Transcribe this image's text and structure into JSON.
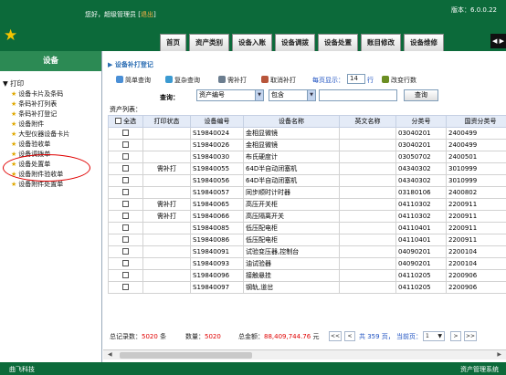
{
  "header": {
    "greeting_prefix": "您好，超级管理员 [",
    "logout": "退出",
    "greeting_suffix": "]",
    "version": "版本：6.0.0.22",
    "nav_tabs": [
      "首页",
      "资产类别",
      "设备入账",
      "设备调拨",
      "设备处置",
      "账目修改",
      "设备维修"
    ],
    "nav_arrows": "◀ ▶"
  },
  "sidebar": {
    "title": "设备",
    "root": "打印",
    "items": [
      "设备卡片及条码",
      "条码补打列表",
      "条码补打登记",
      "设备附件",
      "大型仪器设备卡片",
      "设备验收单",
      "设备调拨单",
      "设备处置单",
      "设备附件验收单",
      "设备附件处置单"
    ]
  },
  "main": {
    "breadcrumb": "设备补打登记",
    "toolbar": {
      "simple_query": "简单查询",
      "complex_query": "复杂查询",
      "reprint": "需补打",
      "cancel_reprint": "取消补打",
      "per_page_label": "每页显示：",
      "per_page_value": "14",
      "per_page_unit": "行",
      "set_rows": "改变行数"
    },
    "query": {
      "label": "查询：",
      "field": "资产编号",
      "operator": "包含",
      "value": "",
      "button": "查询"
    },
    "list_label": "资产列表：",
    "table": {
      "columns": [
        "全选",
        "打印状态",
        "设备编号",
        "设备名称",
        "英文名称",
        "分类号",
        "国资分类号"
      ],
      "rows": [
        [
          "",
          "S19840024",
          "金相显微镜",
          "",
          "03040201",
          "2400499"
        ],
        [
          "",
          "S19840026",
          "金相显微镜",
          "",
          "03040201",
          "2400499"
        ],
        [
          "",
          "S19840030",
          "布氏硬度计",
          "",
          "03050702",
          "2400501"
        ],
        [
          "需补打",
          "S19840055",
          "64D半自动闭塞机",
          "",
          "04340302",
          "3010999"
        ],
        [
          "",
          "S19840056",
          "64D半自动闭塞机",
          "",
          "04340302",
          "3010999"
        ],
        [
          "",
          "S19840057",
          "同步顺时计时器",
          "",
          "03180106",
          "2400802"
        ],
        [
          "需补打",
          "S19840065",
          "高压开关柜",
          "",
          "04110302",
          "2200911"
        ],
        [
          "需补打",
          "S19840066",
          "高压隔离开关",
          "",
          "04110302",
          "2200911"
        ],
        [
          "",
          "S19840085",
          "低压配电柜",
          "",
          "04110401",
          "2200911"
        ],
        [
          "",
          "S19840086",
          "低压配电柜",
          "",
          "04110401",
          "2200911"
        ],
        [
          "",
          "S19840091",
          "试验变压器,控制台",
          "",
          "04090201",
          "2200104"
        ],
        [
          "",
          "S19840093",
          "油试验器",
          "",
          "04090201",
          "2200104"
        ],
        [
          "",
          "S19840096",
          "接触悬挂",
          "",
          "04110205",
          "2200906"
        ],
        [
          "",
          "S19840097",
          "钢轨,道岔",
          "",
          "04110205",
          "2200906"
        ]
      ]
    },
    "pager": {
      "total_label": "总记录数：",
      "total": "5020",
      "total_unit": "条",
      "count_label": "数量：",
      "count": "5020",
      "amount_label": "总金额：",
      "amount": "88,409,744.76",
      "amount_unit": "元",
      "first": "<<",
      "prev": "<",
      "pages_text": "共 359 页，",
      "current_label": "当前页：",
      "current_page": "1",
      "next": ">",
      "last": ">>"
    }
  },
  "footer": {
    "company": "曲飞科技",
    "system": "资产管理系统"
  },
  "colors": {
    "header_green": "#0c6a3a",
    "sidebar_header": "#2c8a54",
    "link_blue": "#1b4fc0",
    "highlight_red": "#e00000"
  }
}
